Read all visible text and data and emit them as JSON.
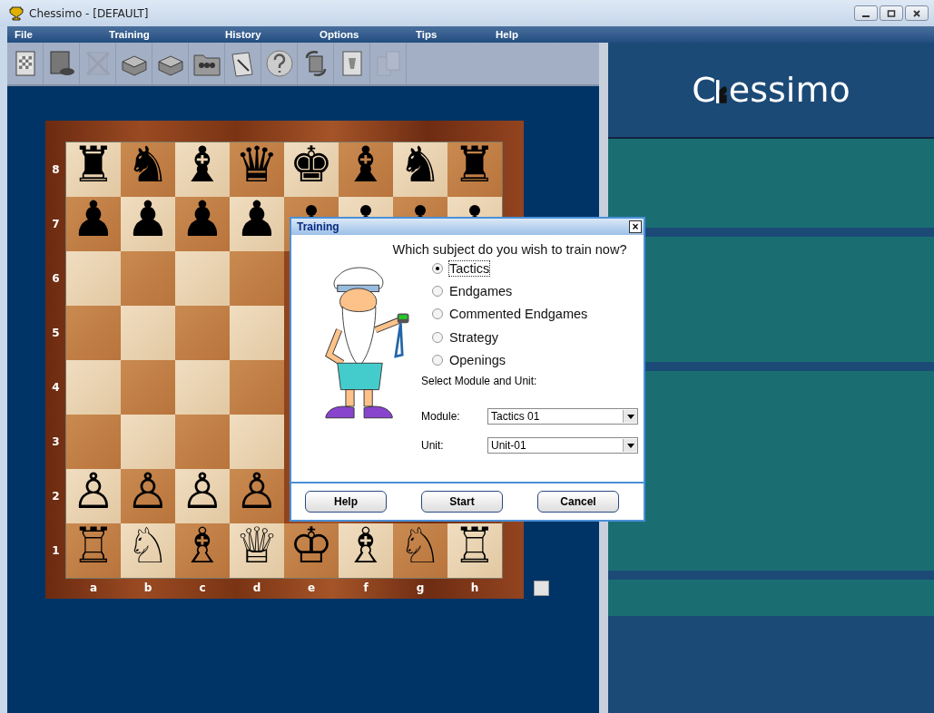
{
  "window": {
    "title": "Chessimo - [DEFAULT]"
  },
  "menu": [
    {
      "label": "File"
    },
    {
      "label": "Training"
    },
    {
      "label": "History"
    },
    {
      "label": "Options"
    },
    {
      "label": "Tips"
    },
    {
      "label": "Help"
    }
  ],
  "toolbar": [
    {
      "kind": "board",
      "disabled": false
    },
    {
      "kind": "board-gamepad",
      "disabled": false
    },
    {
      "kind": "board-cross",
      "disabled": true
    },
    {
      "kind": "box",
      "disabled": false
    },
    {
      "kind": "box",
      "disabled": false
    },
    {
      "kind": "folder",
      "disabled": false
    },
    {
      "kind": "papers",
      "disabled": false
    },
    {
      "kind": "question",
      "disabled": false
    },
    {
      "kind": "board-arrows",
      "disabled": false
    },
    {
      "kind": "document",
      "disabled": false
    },
    {
      "kind": "boards",
      "disabled": true
    }
  ],
  "board": {
    "ranks": [
      {
        "label": "8",
        "squares": [
          {
            "kind": "piece",
            "piece": "♜"
          },
          {
            "kind": "piece",
            "piece": "♞"
          },
          {
            "kind": "piece",
            "piece": "♝"
          },
          {
            "kind": "piece",
            "piece": "♛"
          },
          {
            "kind": "piece",
            "piece": "♚"
          },
          {
            "kind": "piece",
            "piece": "♝"
          },
          {
            "kind": "piece",
            "piece": "♞"
          },
          {
            "kind": "piece",
            "piece": "♜"
          }
        ]
      },
      {
        "label": "7",
        "squares": [
          {
            "kind": "piece",
            "piece": "♟"
          },
          {
            "kind": "piece",
            "piece": "♟"
          },
          {
            "kind": "piece",
            "piece": "♟"
          },
          {
            "kind": "piece",
            "piece": "♟"
          },
          {
            "kind": "covered-pawn"
          },
          {
            "kind": "covered-pawn"
          },
          {
            "kind": "covered-pawn"
          },
          {
            "kind": "covered-pawn"
          }
        ]
      },
      {
        "label": "6",
        "squares": [
          {
            "kind": "empty"
          },
          {
            "kind": "empty"
          },
          {
            "kind": "empty"
          },
          {
            "kind": "empty"
          },
          {
            "kind": "covered"
          },
          {
            "kind": "covered"
          },
          {
            "kind": "covered"
          },
          {
            "kind": "covered"
          }
        ]
      },
      {
        "label": "5",
        "squares": [
          {
            "kind": "empty"
          },
          {
            "kind": "empty"
          },
          {
            "kind": "empty"
          },
          {
            "kind": "empty"
          },
          {
            "kind": "covered"
          },
          {
            "kind": "covered"
          },
          {
            "kind": "covered"
          },
          {
            "kind": "covered"
          }
        ]
      },
      {
        "label": "4",
        "squares": [
          {
            "kind": "empty"
          },
          {
            "kind": "empty"
          },
          {
            "kind": "empty"
          },
          {
            "kind": "empty"
          },
          {
            "kind": "covered"
          },
          {
            "kind": "covered"
          },
          {
            "kind": "covered"
          },
          {
            "kind": "covered"
          }
        ]
      },
      {
        "label": "3",
        "squares": [
          {
            "kind": "empty"
          },
          {
            "kind": "empty"
          },
          {
            "kind": "empty"
          },
          {
            "kind": "empty"
          },
          {
            "kind": "covered"
          },
          {
            "kind": "covered"
          },
          {
            "kind": "covered"
          },
          {
            "kind": "covered"
          }
        ]
      },
      {
        "label": "2",
        "squares": [
          {
            "kind": "piece",
            "piece": "♙"
          },
          {
            "kind": "piece",
            "piece": "♙"
          },
          {
            "kind": "piece",
            "piece": "♙"
          },
          {
            "kind": "piece",
            "piece": "♙"
          },
          {
            "kind": "covered"
          },
          {
            "kind": "covered"
          },
          {
            "kind": "covered"
          },
          {
            "kind": "covered"
          }
        ]
      },
      {
        "label": "1",
        "squares": [
          {
            "kind": "piece",
            "piece": "♖"
          },
          {
            "kind": "piece",
            "piece": "♘"
          },
          {
            "kind": "piece",
            "piece": "♗"
          },
          {
            "kind": "piece",
            "piece": "♕"
          },
          {
            "kind": "piece",
            "piece": "♔"
          },
          {
            "kind": "piece",
            "piece": "♗"
          },
          {
            "kind": "piece",
            "piece": "♘"
          },
          {
            "kind": "piece",
            "piece": "♖"
          }
        ]
      }
    ],
    "files": [
      "a",
      "b",
      "c",
      "d",
      "e",
      "f",
      "g",
      "h"
    ]
  },
  "logo": {
    "before": "C",
    "after": "essimo"
  },
  "dialog": {
    "title": "Training",
    "close": "×",
    "question": "Which subject do you wish to train now?",
    "options": [
      {
        "label": "Tactics",
        "selected": true
      },
      {
        "label": "Endgames",
        "selected": false
      },
      {
        "label": "Commented Endgames",
        "selected": false
      },
      {
        "label": "Strategy",
        "selected": false
      },
      {
        "label": "Openings",
        "selected": false
      }
    ],
    "section": "Select Module and Unit:",
    "fields": [
      {
        "label": "Module:",
        "value": "Tactics 01"
      },
      {
        "label": "Unit:",
        "value": "Unit-01"
      }
    ],
    "buttons": [
      "Help",
      "Start",
      "Cancel"
    ]
  }
}
